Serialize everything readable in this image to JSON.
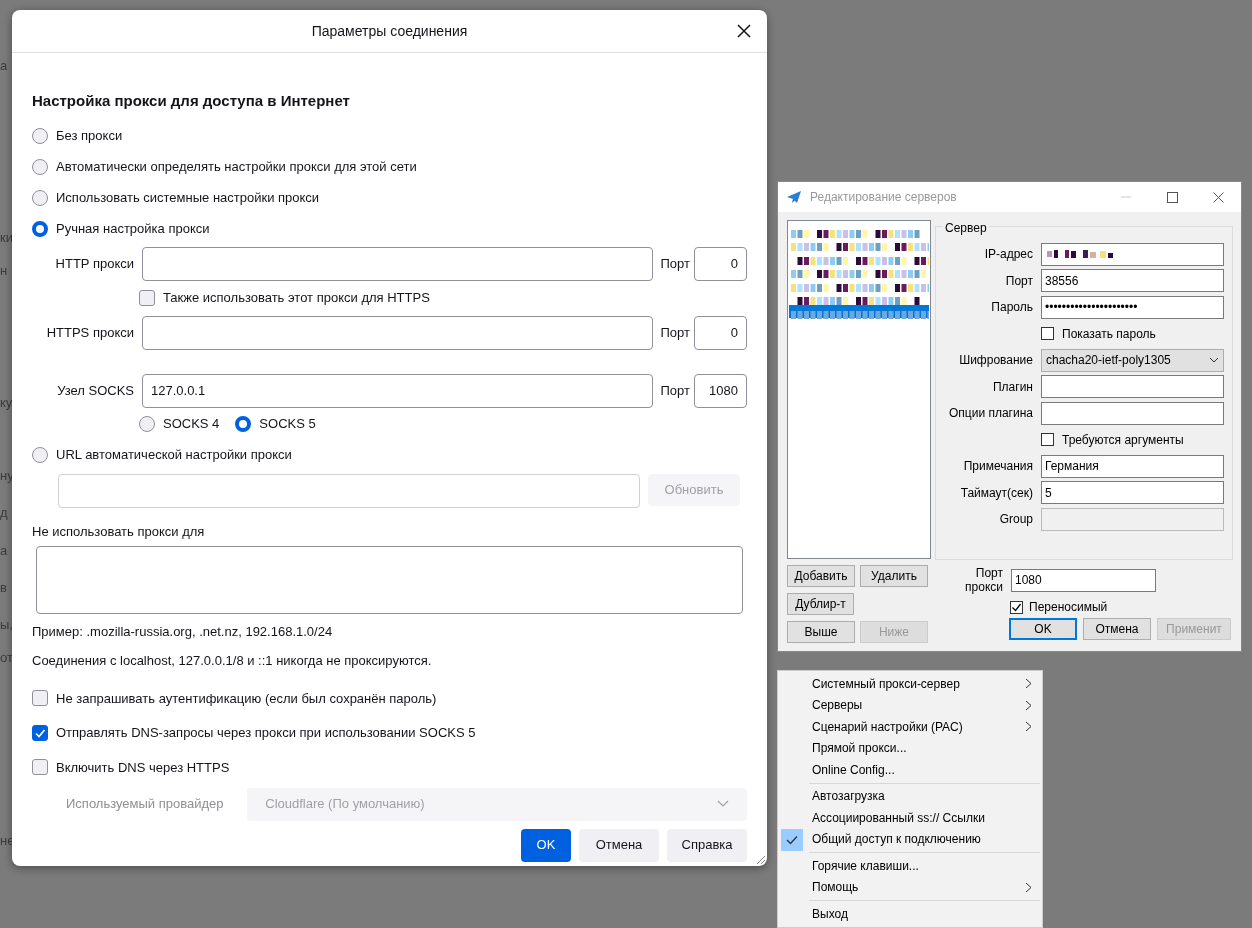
{
  "background_fragments": [
    "а",
    "ки",
    "н",
    "ку",
    "ну",
    "д",
    "а",
    "в",
    "ы,",
    "от",
    "не"
  ],
  "connection_dialog": {
    "title": "Параметры соединения",
    "heading": "Настройка прокси для доступа в Интернет",
    "proxy_modes": [
      {
        "label": "Без прокси",
        "selected": false
      },
      {
        "label": "Автоматически определять настройки прокси для этой сети",
        "selected": false
      },
      {
        "label": "Использовать системные настройки прокси",
        "selected": false
      },
      {
        "label": "Ручная настройка прокси",
        "selected": true
      },
      {
        "label": "URL автоматической настройки прокси",
        "selected": false
      }
    ],
    "http_proxy": {
      "label": "HTTP прокси",
      "port_label": "Порт",
      "port": "0"
    },
    "also_https": {
      "label": "Также использовать этот прокси для HTTPS",
      "checked": false
    },
    "https_proxy": {
      "label": "HTTPS прокси",
      "port_label": "Порт",
      "port": "0"
    },
    "socks_host": {
      "label": "Узел SOCKS",
      "value": "127.0.0.1",
      "port_label": "Порт",
      "port": "1080"
    },
    "socks_versions": [
      {
        "label": "SOCKS 4",
        "selected": false
      },
      {
        "label": "SOCKS 5",
        "selected": true
      }
    ],
    "reload_button": {
      "label": "Обновить",
      "disabled": true
    },
    "no_proxy_label": "Не использовать прокси для",
    "example": "Пример: .mozilla-russia.org, .net.nz, 192.168.1.0/24",
    "localhost_note": "Соединения с localhost, 127.0.0.1/8 и ::1 никогда не проксируются.",
    "options": [
      {
        "label": "Не запрашивать аутентификацию (если был сохранён пароль)",
        "checked": false
      },
      {
        "label": "Отправлять DNS-запросы через прокси при использовании SOCKS 5",
        "checked": true
      },
      {
        "label": "Включить DNS через HTTPS",
        "checked": false
      }
    ],
    "provider": {
      "label": "Используемый провайдер",
      "value": "Cloudflare (По умолчанию)",
      "disabled": true
    },
    "buttons": [
      {
        "label": "OK",
        "kind": "primary"
      },
      {
        "label": "Отмена",
        "kind": "secondary"
      },
      {
        "label": "Справка",
        "kind": "secondary"
      }
    ]
  },
  "server_editor": {
    "title": "Редактирование серверов",
    "servers": [
      {
        "selected": false
      },
      {
        "selected": false
      },
      {
        "selected": false
      },
      {
        "selected": false
      },
      {
        "selected": false
      },
      {
        "selected": false
      },
      {
        "selected": true
      }
    ],
    "group_label": "Сервер",
    "fields": [
      {
        "kind": "redacted",
        "label": "IP-адрес"
      },
      {
        "kind": "text",
        "label": "Порт",
        "value": "38556"
      },
      {
        "kind": "text",
        "label": "Пароль",
        "value": "••••••••••••••••••••••"
      },
      {
        "kind": "checkbox",
        "label": "Показать пароль",
        "checked": false
      },
      {
        "kind": "select",
        "label": "Шифрование",
        "value": "chacha20-ietf-poly1305"
      },
      {
        "kind": "text",
        "label": "Плагин"
      },
      {
        "kind": "text",
        "label": "Опции плагина"
      },
      {
        "kind": "checkbox",
        "label": "Требуются аргументы",
        "checked": false
      },
      {
        "kind": "text",
        "label": "Примечания",
        "value": "Германия"
      },
      {
        "kind": "text",
        "label": "Таймаут(сек)",
        "value": "5"
      },
      {
        "kind": "text",
        "label": "Group",
        "disabled": true
      }
    ],
    "list_buttons": [
      {
        "label": "Добавить",
        "disabled": false
      },
      {
        "label": "Удалить",
        "disabled": false
      },
      {
        "label": "Дублир-т",
        "disabled": false
      },
      {
        "label": "Выше",
        "disabled": false
      },
      {
        "label": "Ниже",
        "disabled": true
      }
    ],
    "proxy_port": {
      "label": "Порт прокси",
      "value": "1080"
    },
    "portable": {
      "label": "Переносимый",
      "checked": true
    },
    "dialog_buttons": [
      {
        "label": "OK",
        "default": true,
        "disabled": false
      },
      {
        "label": "Отмена",
        "default": false,
        "disabled": false
      },
      {
        "label": "Применит",
        "default": false,
        "disabled": true
      }
    ]
  },
  "tray_menu": {
    "items": [
      {
        "kind": "item",
        "label": "Системный прокси-сервер",
        "submenu": true,
        "checked": false
      },
      {
        "kind": "item",
        "label": "Серверы",
        "submenu": true,
        "checked": false
      },
      {
        "kind": "item",
        "label": "Сценарий настройки (PAC)",
        "submenu": true,
        "checked": false
      },
      {
        "kind": "item",
        "label": "Прямой прокси...",
        "submenu": false,
        "checked": false
      },
      {
        "kind": "item",
        "label": "Online Config...",
        "submenu": false,
        "checked": false
      },
      {
        "kind": "separator"
      },
      {
        "kind": "item",
        "label": "Автозагрузка",
        "submenu": false,
        "checked": false
      },
      {
        "kind": "item",
        "label": "Ассоциированный ss:// Ссылки",
        "submenu": false,
        "checked": false
      },
      {
        "kind": "item",
        "label": "Общий доступ к подключению",
        "submenu": false,
        "checked": true
      },
      {
        "kind": "separator"
      },
      {
        "kind": "item",
        "label": "Горячие клавиши...",
        "submenu": false,
        "checked": false
      },
      {
        "kind": "item",
        "label": "Помощь",
        "submenu": true,
        "checked": false
      },
      {
        "kind": "separator"
      },
      {
        "kind": "item",
        "label": "Выход",
        "submenu": false,
        "checked": false
      }
    ]
  }
}
